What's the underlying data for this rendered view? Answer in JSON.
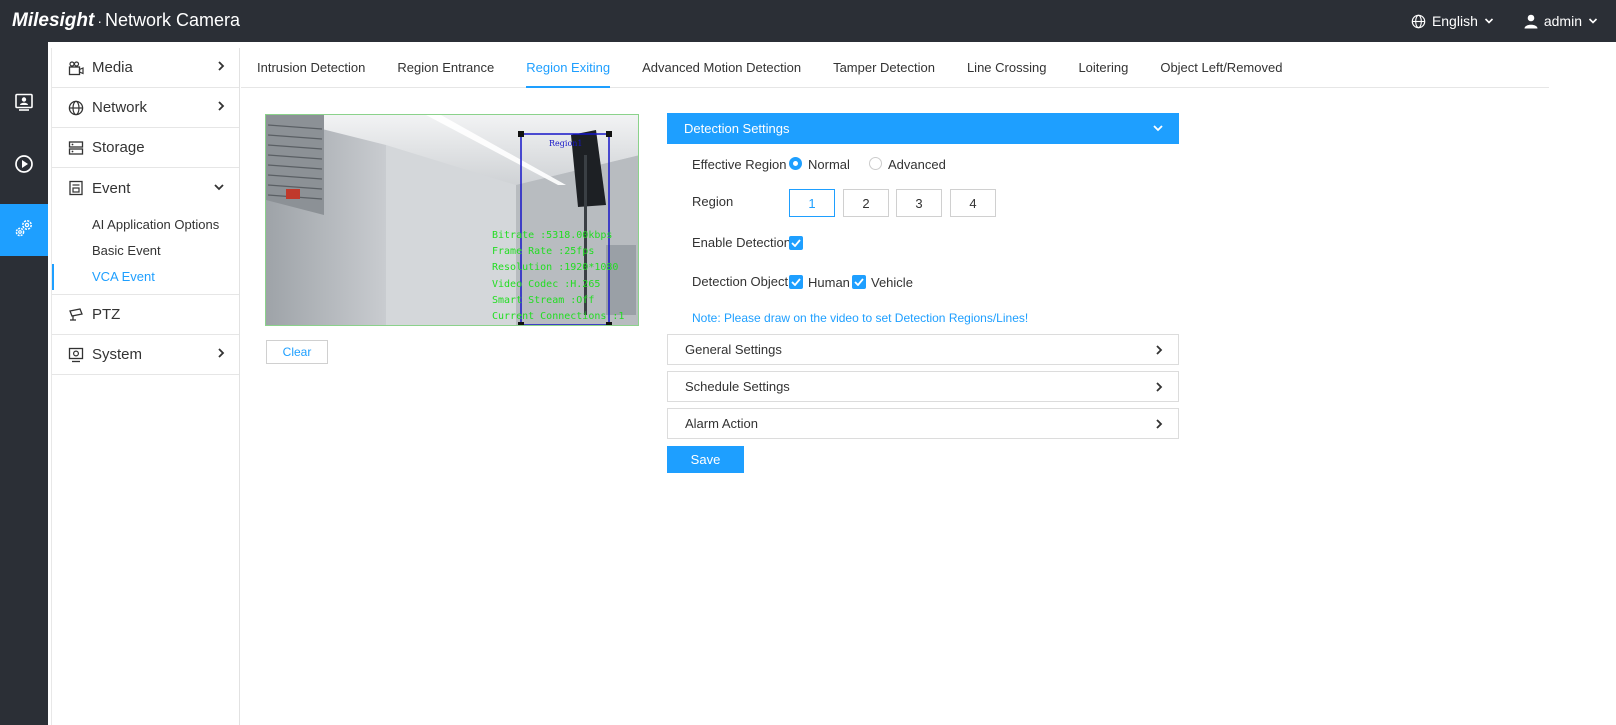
{
  "topbar": {
    "logo": "Milesight",
    "separator": "·",
    "product": "Network Camera",
    "language": "English",
    "user": "admin"
  },
  "rail": {
    "items": [
      {
        "icon": "live-view-icon"
      },
      {
        "icon": "playback-icon"
      },
      {
        "icon": "settings-icon"
      }
    ]
  },
  "sidebar": {
    "media": "Media",
    "network": "Network",
    "storage": "Storage",
    "event": "Event",
    "event_sub": [
      "AI Application Options",
      "Basic Event",
      "VCA Event"
    ],
    "ptz": "PTZ",
    "system": "System"
  },
  "tabs": [
    "Intrusion Detection",
    "Region Entrance",
    "Region Exiting",
    "Advanced Motion Detection",
    "Tamper Detection",
    "Line Crossing",
    "Loitering",
    "Object Left/Removed"
  ],
  "video": {
    "region_label": "Region1",
    "overlay_lines": [
      "Bitrate :5318.00kbps",
      "Frame Rate :25fps",
      "Resolution :1920*1080",
      "Video Codec :H.265",
      "Smart Stream :Off",
      "Current Connections :1"
    ]
  },
  "clear_label": "Clear",
  "detection": {
    "header": "Detection Settings",
    "effective_region_label": "Effective Region",
    "normal_label": "Normal",
    "advanced_label": "Advanced",
    "region_label": "Region",
    "regions": [
      "1",
      "2",
      "3",
      "4"
    ],
    "enable_detection_label": "Enable Detection",
    "detection_object_label": "Detection Object",
    "human_label": "Human",
    "vehicle_label": "Vehicle",
    "note": "Note: Please draw on the video to set Detection Regions/Lines!"
  },
  "panels": {
    "general": "General Settings",
    "schedule": "Schedule Settings",
    "alarm": "Alarm Action"
  },
  "save_label": "Save",
  "colors": {
    "accent": "#1e9fff",
    "topbar": "#2b2f36",
    "overlay_text": "#22dd22",
    "region_box": "#1515c8"
  }
}
